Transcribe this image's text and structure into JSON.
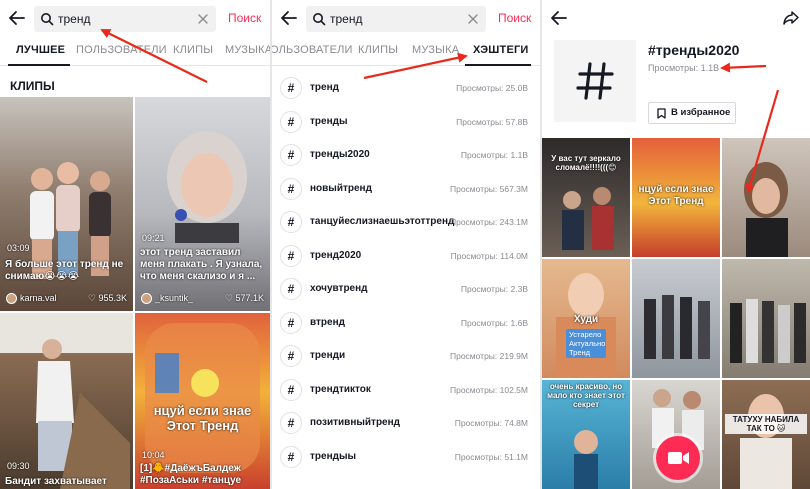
{
  "panel1": {
    "search": {
      "value": "тренд",
      "button_label": "Поиск"
    },
    "tabs": [
      {
        "label": "ЛУЧШЕЕ",
        "active": true
      },
      {
        "label": "ПОЛЬЗОВАТЕЛИ",
        "active": false
      },
      {
        "label": "КЛИПЫ",
        "active": false
      },
      {
        "label": "МУЗЫКА",
        "active": false
      }
    ],
    "section_title": "КЛИПЫ",
    "clips": [
      {
        "duration": "03:09",
        "caption": "Я больше этот тренд не снимаю😭😭😭",
        "user": "karna.val",
        "likes": "955.3K"
      },
      {
        "duration": "09:21",
        "caption": "этот тренд заставил меня плакать . Я узнала, что меня скализо и я ...",
        "user": "_ksuntik_",
        "likes": "577.1K"
      },
      {
        "duration": "09:30",
        "caption": "Бандит захватывает",
        "user": "",
        "likes": ""
      },
      {
        "duration": "10:04",
        "caption": "[1]🐥#ДаёжъБалдеж #ПозаАськи #танцуе",
        "overlay": "нцуй если знае Этот Тренд",
        "user": "",
        "likes": ""
      }
    ]
  },
  "panel2": {
    "search": {
      "value": "тренд",
      "button_label": "Поиск"
    },
    "tabs": [
      {
        "label": "ОЛЬЗОВАТЕЛИ",
        "active": false
      },
      {
        "label": "КЛИПЫ",
        "active": false
      },
      {
        "label": "МУЗЫКА",
        "active": false
      },
      {
        "label": "ХЭШТЕГИ",
        "active": true
      }
    ],
    "hashtags": [
      {
        "name": "тренд",
        "views": "Просмотры: 25.0B"
      },
      {
        "name": "тренды",
        "views": "Просмотры: 57.8B"
      },
      {
        "name": "тренды2020",
        "views": "Просмотры: 1.1B"
      },
      {
        "name": "новыйтренд",
        "views": "Просмотры: 567.3M"
      },
      {
        "name": "танцуйеслизнаешьэтоттренд",
        "views": "Просмотры: 243.1M"
      },
      {
        "name": "тренд2020",
        "views": "Просмотры: 114.0M"
      },
      {
        "name": "хочувтренд",
        "views": "Просмотры: 2.3B"
      },
      {
        "name": "втренд",
        "views": "Просмотры: 1.6B"
      },
      {
        "name": "тренди",
        "views": "Просмотры: 219.9M"
      },
      {
        "name": "трендтикток",
        "views": "Просмотры: 102.5M"
      },
      {
        "name": "позитивныйтренд",
        "views": "Просмотры: 74.8M"
      },
      {
        "name": "трендыы",
        "views": "Просмотры: 51.1M"
      }
    ]
  },
  "panel3": {
    "title": "#тренды2020",
    "views": "Просмотры: 1.1B",
    "fav_label": "В избранное",
    "tiles": [
      {
        "caption": "У вас тут зеркало сломалё!!!!(((😊"
      },
      {
        "caption": "нцуй если знае Этот Тренд"
      },
      {
        "caption": ""
      },
      {
        "caption": "Худи",
        "badge": "Устарело Актуально Тренд"
      },
      {
        "caption": ""
      },
      {
        "caption": ""
      },
      {
        "caption": "очень красиво, но мало кто знает этот секрет"
      },
      {
        "caption": ""
      },
      {
        "caption": "ТАТУХУ НАБИЛА ТАК ТО 🐱"
      }
    ]
  },
  "colors": {
    "accent": "#fe2c55",
    "text": "#161823",
    "muted": "#8a8b91",
    "annotation": "#e8291c"
  }
}
